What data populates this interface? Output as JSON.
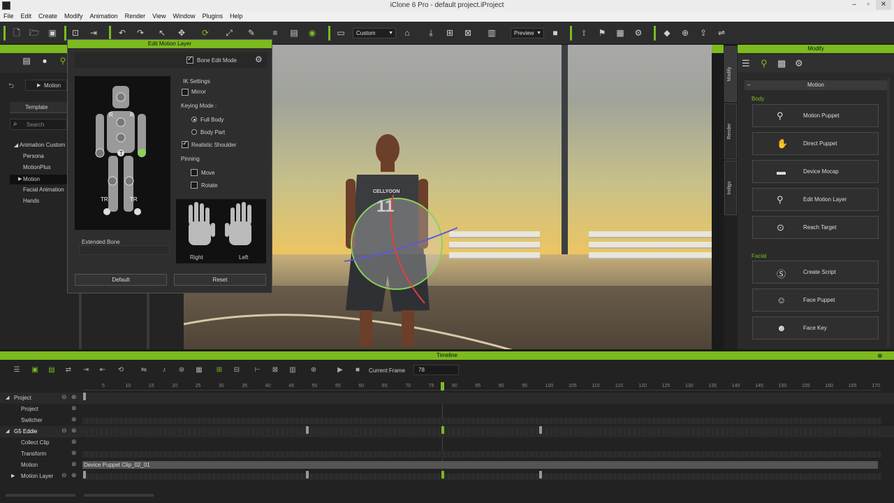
{
  "window": {
    "title": "iClone 6 Pro - default project.iProject"
  },
  "menu": [
    "File",
    "Edit",
    "Create",
    "Modify",
    "Animation",
    "Render",
    "View",
    "Window",
    "Plugins",
    "Help"
  ],
  "toolbar": {
    "camera_select": "Custom",
    "render_select": "Preview"
  },
  "left": {
    "tabs": [
      "folder-icon",
      "person-icon",
      "motion-icon"
    ],
    "breadcrumb": "Motion",
    "template_tab": "Template",
    "search_placeholder": "Search",
    "tree": [
      {
        "label": "Animation Custom"
      },
      {
        "label": "Persona"
      },
      {
        "label": "MotionPlus"
      },
      {
        "label": "Motion"
      },
      {
        "label": "Facial Animation"
      },
      {
        "label": "Hands"
      }
    ]
  },
  "edit_panel": {
    "title": "Edit Motion Layer",
    "bone_edit_mode": "Bone Edit Mode",
    "ik_settings": "IK Settings",
    "mirror": "Mirror",
    "keying_mode": "Keying Mode :",
    "full_body": "Full Body",
    "body_part": "Body Part",
    "realistic_shoulder": "Realistic Shoulder",
    "pinning": "Pinning",
    "move": "Move",
    "rotate": "Rotate",
    "extended_bone": "Extended Bone",
    "right": "Right",
    "left": "Left",
    "default_btn": "Default",
    "reset_btn": "Reset",
    "tr1": "TR",
    "tr2": "TR",
    "r1": "R",
    "r2": "R",
    "t": "T"
  },
  "viewport": {
    "jersey_name": "CELLYOON",
    "jersey_number": "11"
  },
  "side_tabs": [
    "Modify",
    "Render",
    "Indigo"
  ],
  "modify": {
    "title": "Modify",
    "section": "Motion",
    "body_label": "Body",
    "body_buttons": [
      "Motion Puppet",
      "Direct Puppet",
      "Device Mocap",
      "Edit Motion Layer",
      "Reach Target"
    ],
    "facial_label": "Facial",
    "facial_buttons": [
      "Create Script",
      "Face Puppet",
      "Face Key"
    ]
  },
  "timeline": {
    "title": "Timeline",
    "current_frame_label": "Current Frame",
    "current_frame": "78",
    "ruler": [
      "5",
      "10",
      "15",
      "20",
      "25",
      "30",
      "35",
      "40",
      "45",
      "50",
      "55",
      "60",
      "65",
      "70",
      "75",
      "80",
      "85",
      "90",
      "95",
      "100",
      "105",
      "110",
      "115",
      "120",
      "125",
      "130",
      "135",
      "140",
      "145",
      "150",
      "155",
      "160",
      "165",
      "170"
    ],
    "tracks": [
      "Project",
      "Project",
      "Switcher",
      "G5 Eddie",
      "Collect Clip",
      "Transform",
      "Motion",
      "Motion Layer"
    ],
    "clip_label": "Device Puppet Clip_02_01"
  },
  "colors": {
    "accent": "#7cba20"
  }
}
